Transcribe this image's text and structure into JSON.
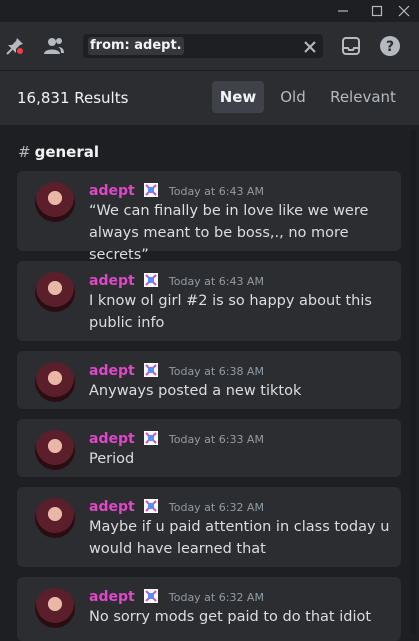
{
  "search": {
    "query": "from: adept."
  },
  "results": {
    "count_label": "16,831 Results",
    "sort_tabs": [
      {
        "label": "New",
        "active": true
      },
      {
        "label": "Old",
        "active": false
      },
      {
        "label": "Relevant",
        "active": false
      }
    ]
  },
  "channel": {
    "hash": "#",
    "name": "general"
  },
  "messages": [
    {
      "author": "adept",
      "time": "Today at 6:43 AM",
      "text": "“We can finally be in love like we were always meant to be boss,., no more secrets”"
    },
    {
      "author": "adept",
      "time": "Today at 6:43 AM",
      "text": "I know ol girl #2 is so happy about this public info"
    },
    {
      "author": "adept",
      "time": "Today at 6:38 AM",
      "text": "Anyways posted a new tiktok"
    },
    {
      "author": "adept",
      "time": "Today at 6:33 AM",
      "text": "Period"
    },
    {
      "author": "adept",
      "time": "Today at 6:32 AM",
      "text": "Maybe if u paid attention in class today u would have learned that"
    },
    {
      "author": "adept",
      "time": "Today at 6:32 AM",
      "text": "No sorry mods get paid to do that idiot"
    }
  ],
  "colors": {
    "author": "#e046c8",
    "accent_bg": "#404249"
  },
  "icons": [
    "minimize-icon",
    "maximize-icon",
    "close-icon",
    "pin-icon",
    "members-icon",
    "clear-search-icon",
    "inbox-icon",
    "help-icon",
    "badge-icon"
  ]
}
